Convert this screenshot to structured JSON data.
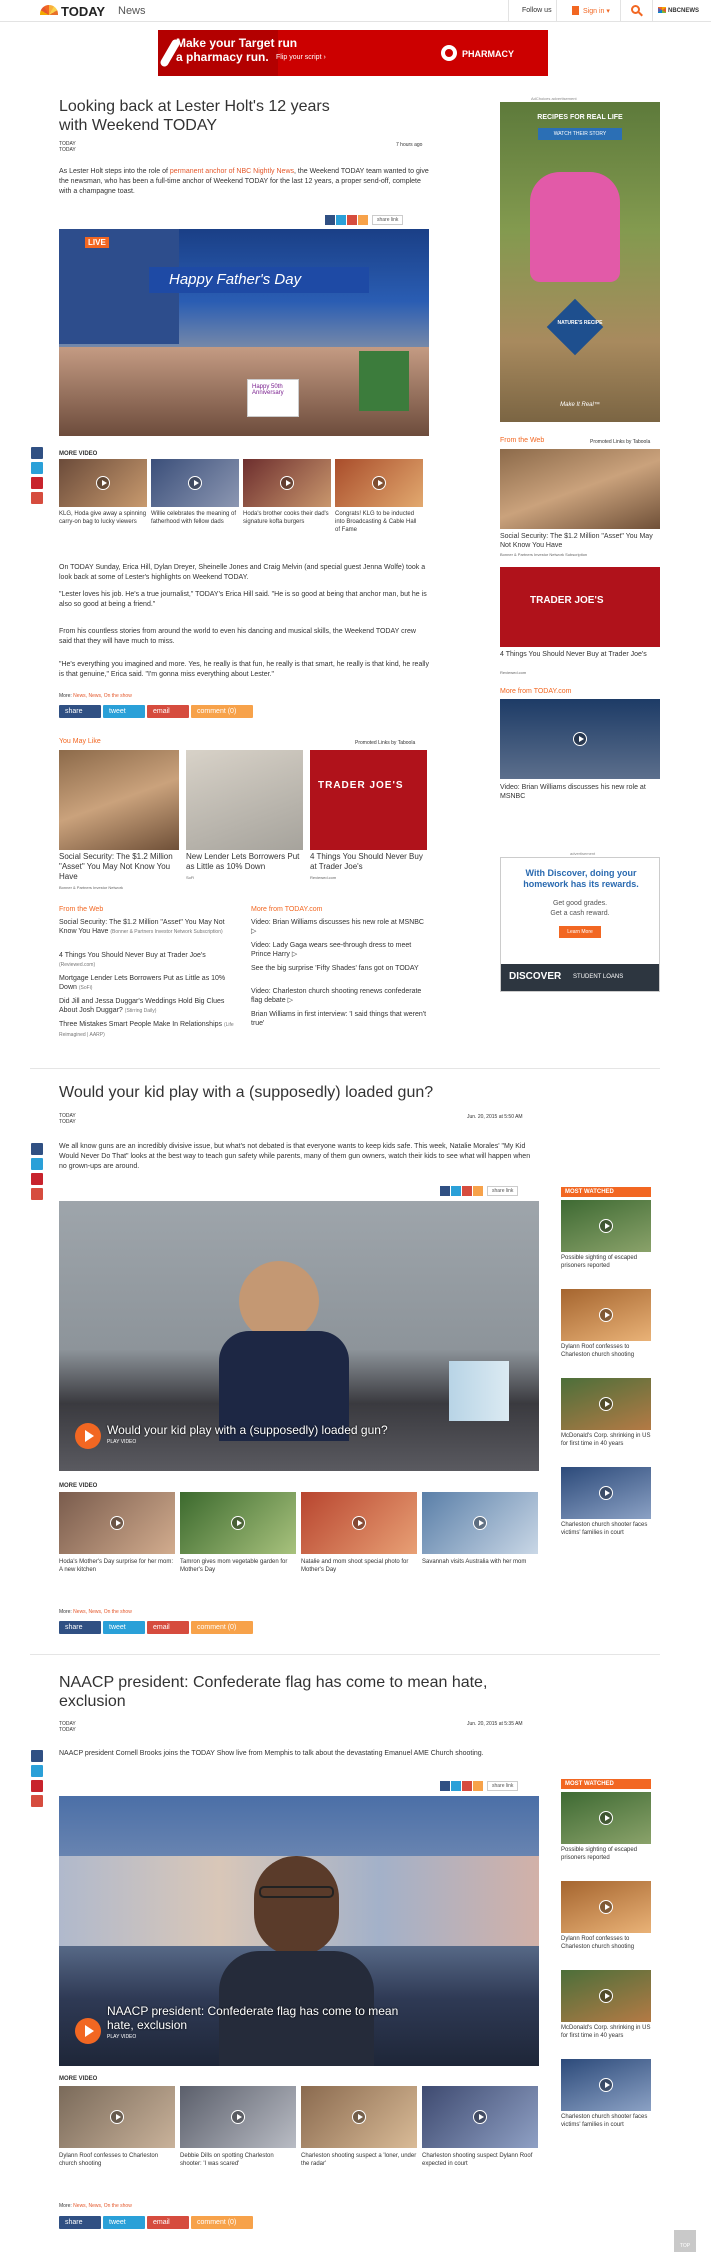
{
  "header": {
    "brand": "TODAY",
    "section": "News",
    "follow_us": "Follow us",
    "sign_in": "Sign in ▾",
    "nbcnews": "NBCNEWS"
  },
  "ad_banner": {
    "headline": "Make your Target run",
    "headline2": "a pharmacy run.",
    "cta": "Flip your script ›",
    "brand": "PHARMACY"
  },
  "article1": {
    "title": "Looking back at Lester Holt's 12 years with Weekend TODAY",
    "byline1": "TODAY",
    "byline2": "TODAY",
    "time": "7 hours ago",
    "lede_pre": "As Lester Holt steps into the role of ",
    "lede_link": "permanent anchor of NBC Nightly News",
    "lede_post": ", the Weekend TODAY team wanted to give the newsman, who has been a full-time anchor of Weekend TODAY for the last 12 years, a proper send-off, complete with a champagne toast.",
    "share_link": "share link",
    "hero_live": "LIVE",
    "hero_banner": "Happy Father's Day",
    "sign_text": "Happy 50th Anniversary",
    "more_video": "MORE VIDEO",
    "videos": [
      "KLG, Hoda give away a spinning carry-on bag to lucky viewers",
      "Willie celebrates the meaning of fatherhood with fellow dads",
      "Hoda's brother cooks their dad's signature kofta burgers",
      "Congrats! KLG to be inducted into Broadcasting & Cable Hall of Fame"
    ],
    "p1": "On TODAY Sunday, Erica Hill, Dylan Dreyer, Sheinelle Jones and Craig Melvin (and special guest Jenna Wolfe) took a look back at some of Lester's highlights on Weekend TODAY.",
    "p2": "\"Lester loves his job. He's a true journalist,\" TODAY's Erica Hill said. \"He is so good at being that anchor man, but he is also so good at being a friend.\"",
    "p3": "From his countless stories from around the world to even his dancing and musical skills, the Weekend TODAY crew said that they will have much to miss.",
    "p4": "\"He's everything you imagined and more. Yes, he really is that fun, he really is that smart, he really is that kind, he really is that genuine,\" Erica said. \"I'm gonna miss everything about Lester.\"",
    "more_label": "More:",
    "more_links": "News, News, On the show",
    "share": "share",
    "tweet": "tweet",
    "email": "email",
    "comment": "comment (0)"
  },
  "you_may_like": {
    "heading": "You May Like",
    "promoted": "Promoted Links by Taboola",
    "items": [
      {
        "title": "Social Security: The $1.2 Million \"Asset\" You May Not Know You Have",
        "source": "Bonner & Partners Investor Network"
      },
      {
        "title": "New Lender Lets Borrowers Put as Little as 10% Down",
        "source": "SoFi"
      },
      {
        "title": "4 Things You Should Never Buy at Trader Joe's",
        "source": "Reviewed.com"
      }
    ],
    "trader_sign": "TRADER JOE'S"
  },
  "from_web": {
    "heading": "From the Web",
    "items": [
      {
        "title": "Social Security: The $1.2 Million \"Asset\" You May Not Know You Have",
        "source": "(Bonner & Partners Investor Network Subscription)"
      },
      {
        "title": "4 Things You Should Never Buy at Trader Joe's",
        "source": "(Reviewed.com)"
      },
      {
        "title": "Mortgage Lender Lets Borrowers Put as Little as 10% Down",
        "source": "(SoFi)"
      },
      {
        "title": "Did Jill and Jessa Duggar's Weddings Hold Big Clues About Josh Duggar?",
        "source": "(Stirring Daily)"
      },
      {
        "title": "Three Mistakes Smart People Make In Relationships",
        "source": "(Life Reimagined | AARP)"
      }
    ]
  },
  "from_today": {
    "heading": "More from TODAY.com",
    "items": [
      "Video: Brian Williams discusses his new role at MSNBC ▷",
      "Video: Lady Gaga wears see-through dress to meet Prince Harry ▷",
      "See the big surprise 'Fifty Shades' fans got on TODAY",
      "Video: Charleston church shooting renews confederate flag debate ▷",
      "Brian Williams in first interview: 'I said things that weren't true'"
    ]
  },
  "sidebar": {
    "ad_label": "AdChoices  advertisement",
    "ad1_headline": "RECIPES FOR REAL LIFE",
    "ad1_cta": "WATCH THEIR STORY",
    "ad1_brand": "NATURE'S RECIPE",
    "ad1_tag": "Make It Real™",
    "from_web": "From the Web",
    "promoted": "Promoted Links by Taboola",
    "web_items": [
      {
        "title": "Social Security: The $1.2 Million \"Asset\" You May Not Know You Have",
        "source": "Bonner & Partners Investor Network Subscription"
      },
      {
        "title": "4 Things You Should Never Buy at Trader Joe's",
        "source": "Reviewed.com"
      }
    ],
    "more_today": "More from TODAY.com",
    "today_item": "Video: Brian Williams discusses his new role at MSNBC",
    "ad2_label": "advertisement",
    "ad2_headline": "With Discover, doing your homework has its rewards.",
    "ad2_sub1": "Get good grades.",
    "ad2_sub2": "Get a cash reward.",
    "ad2_cta": "Learn More",
    "ad2_brand": "DISCOVER",
    "ad2_brand2": "STUDENT LOANS"
  },
  "article2": {
    "title": "Would your kid play with a (supposedly) loaded gun?",
    "byline1": "TODAY",
    "byline2": "TODAY",
    "time": "Jun. 20, 2015 at 5:50 AM",
    "lede": "We all know guns are an incredibly divisive issue, but what's not debated is that everyone wants to keep kids safe. This week, Natalie Morales' \"My Kid Would Never Do That\" looks at the best way to teach gun safety while parents, many of them gun owners, watch their kids to see what will happen when no grown-ups are around.",
    "share_link": "share link",
    "video_title": "Would your kid play with a (supposedly) loaded gun?",
    "play_video": "PLAY VIDEO",
    "more_video": "MORE VIDEO",
    "videos": [
      "Hoda's Mother's Day surprise for her mom: A new kitchen",
      "Tamron gives mom vegetable garden for Mother's Day",
      "Natalie and mom shoot special photo for Mother's Day",
      "Savannah visits Australia with her mom"
    ],
    "most_watched": "MOST WATCHED",
    "mw": [
      "Possible sighting of escaped prisoners reported",
      "Dylann Roof confesses to Charleston church shooting",
      "McDonald's Corp. shrinking in US for first time in 40 years",
      "Charleston church shooter faces victims' families in court"
    ],
    "more_label": "More:",
    "more_links": "News, News, On the show",
    "share": "share",
    "tweet": "tweet",
    "email": "email",
    "comment": "comment (0)"
  },
  "article3": {
    "title": "NAACP president: Confederate flag has come to mean hate, exclusion",
    "byline1": "TODAY",
    "byline2": "TODAY",
    "time": "Jun. 20, 2015 at 5:35 AM",
    "lede": "NAACP president Cornell Brooks joins the TODAY Show live from Memphis to talk about the devastating Emanuel AME Church shooting.",
    "share_link": "share link",
    "video_title": "NAACP president: Confederate flag has come to mean hate, exclusion",
    "play_video": "PLAY VIDEO",
    "more_video": "MORE VIDEO",
    "videos": [
      "Dylann Roof confesses to Charleston church shooting",
      "Debbie Dills on spotting Charleston shooter: 'I was scared'",
      "Charleston shooting suspect a 'loner, under the radar'",
      "Charleston shooting suspect Dylann Roof expected in court"
    ],
    "most_watched": "MOST WATCHED",
    "mw": [
      "Possible sighting of escaped prisoners reported",
      "Dylann Roof confesses to Charleston church shooting",
      "McDonald's Corp. shrinking in US for first time in 40 years",
      "Charleston church shooter faces victims' families in court"
    ],
    "more_label": "More:",
    "more_links": "News, News, On the show",
    "share": "share",
    "tweet": "tweet",
    "email": "email",
    "comment": "comment (0)"
  },
  "top_button": "TOP",
  "colors": {
    "accent": "#f26722",
    "link": "#e4582b",
    "facebook": "#305083",
    "twitter": "#2aa0d8",
    "pinterest": "#c8232c",
    "email": "#d64c3e"
  }
}
